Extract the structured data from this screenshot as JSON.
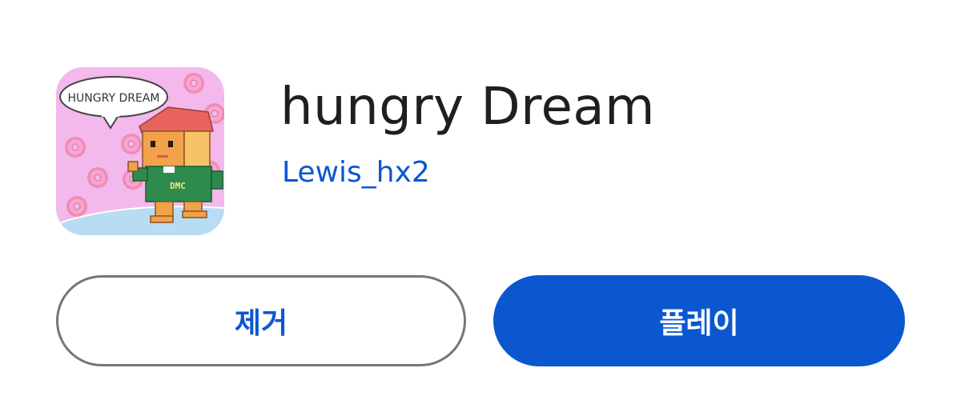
{
  "app": {
    "icon_name": "hungry-dream-app-icon",
    "icon_text": "HUNGRY DREAM",
    "character_shirt_text": "DMC",
    "title": "hungry Dream",
    "developer": "Lewis_hx2"
  },
  "actions": {
    "uninstall_label": "제거",
    "play_label": "플레이"
  },
  "colors": {
    "accent": "#0b57d0",
    "title_text": "#1f1f1f",
    "outline": "#747775",
    "icon_background": "#f3b8ec"
  }
}
